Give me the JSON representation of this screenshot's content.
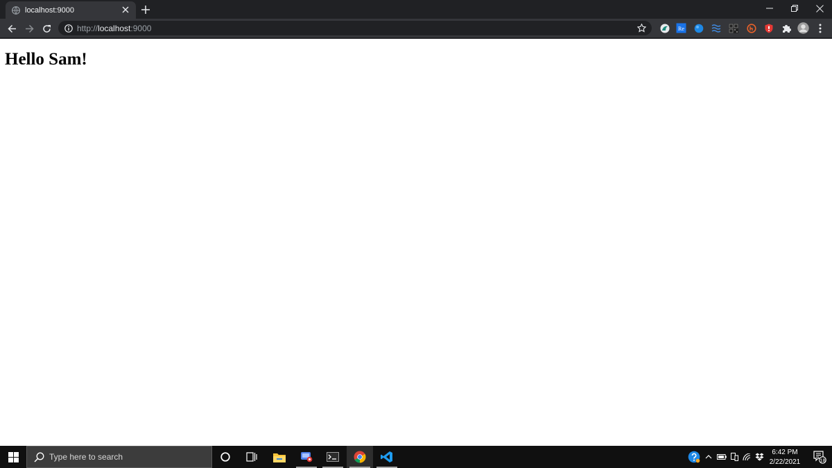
{
  "browser": {
    "tab": {
      "title": "localhost:9000"
    },
    "address_bar": {
      "scheme": "http://",
      "host": "localhost",
      "port": ":9000"
    },
    "extension_re_label": "Re",
    "icons": [
      "globe-icon",
      "close-icon",
      "plus-icon",
      "minimize-icon",
      "restore-icon",
      "back-icon",
      "forward-icon",
      "reload-icon",
      "info-icon",
      "star-icon",
      "puzzle-icon",
      "kebab-menu-icon"
    ]
  },
  "page": {
    "heading": "Hello Sam!"
  },
  "taskbar": {
    "search_placeholder": "Type here to search",
    "clock": {
      "time": "6:42 PM",
      "date": "2/22/2021"
    },
    "notification_count": "18"
  },
  "colors": {
    "tabstrip": "#202124",
    "toolbar": "#35363a",
    "omnibox": "#202124",
    "page_background": "#ffffff",
    "taskbar": "#101010",
    "search_box": "#3c3c3c"
  }
}
